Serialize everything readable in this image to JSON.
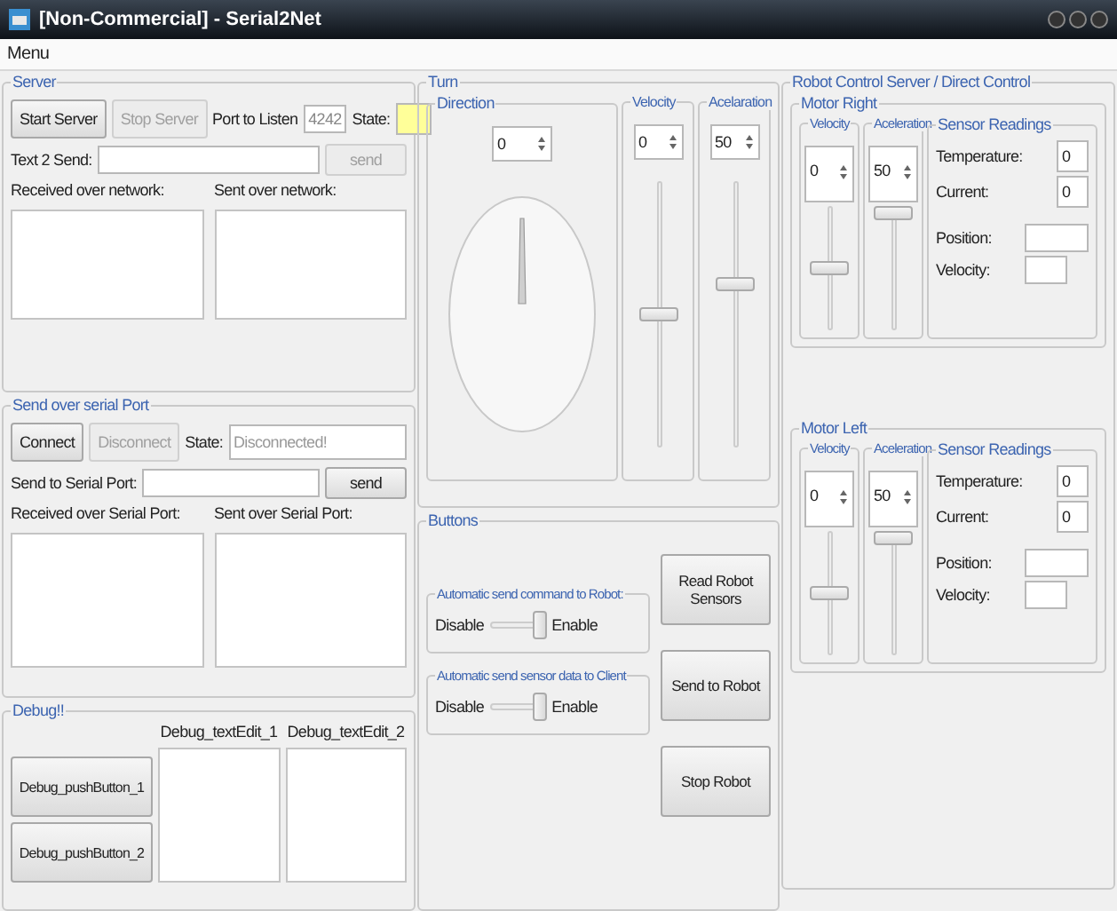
{
  "window": {
    "title": "[Non-Commercial] - Serial2Net"
  },
  "menu": [
    "Menu"
  ],
  "server": {
    "title": "Server",
    "buttons": [
      {
        "label": "Start Server",
        "disabled": false
      },
      {
        "label": "Stop Server",
        "disabled": true
      }
    ],
    "port_label": "Port to Listen",
    "port": "4242",
    "state_label": "State:",
    "text_label": "Text 2 Send:",
    "send": {
      "label": "send",
      "disabled": true
    },
    "received_label": "Received over network:",
    "sent_label": "Sent over network:"
  },
  "serial": {
    "title": "Send over serial Port",
    "buttons": [
      {
        "label": "Connect",
        "disabled": false
      },
      {
        "label": "Disconnect",
        "disabled": true
      }
    ],
    "state_label": "State:",
    "state": "Disconnected!",
    "send_label": "Send to Serial Port:",
    "send": {
      "label": "send",
      "disabled": false
    },
    "received_label": "Received over Serial Port:",
    "sent_label": "Sent over Serial Port:"
  },
  "debug": {
    "title": "Debug!!",
    "buttons": [
      "Debug_pushButton_1",
      "Debug_pushButton_2"
    ],
    "edits": [
      "Debug_textEdit_1",
      "Debug_textEdit_2"
    ]
  },
  "turn": {
    "title": "Turn",
    "direction": {
      "title": "Direction",
      "value": "0"
    },
    "sliders": [
      {
        "title": "Velocity",
        "value": "0",
        "level": 0.5
      },
      {
        "title": "Acelaration",
        "value": "50",
        "level": 0.62
      }
    ]
  },
  "buttons_group": {
    "title": "Buttons",
    "toggles": [
      {
        "title": "Automatic send command to Robot:",
        "off": "Disable",
        "on": "Enable",
        "enabled": true
      },
      {
        "title": "Automatic send sensor data to Client",
        "off": "Disable",
        "on": "Enable",
        "enabled": true
      }
    ],
    "actions": [
      "Read Robot Sensors",
      "Send to Robot",
      "Stop Robot"
    ]
  },
  "robot": {
    "title": "Robot Control Server / Direct Control",
    "motors": [
      {
        "title": "Motor Right",
        "sliders": [
          {
            "title": "Velocity",
            "value": "0",
            "level": 0.5
          },
          {
            "title": "Aceleration",
            "value": "50",
            "level": 1
          }
        ],
        "sensors": {
          "title": "Sensor Readings",
          "fields": [
            {
              "label": "Temperature:",
              "value": "0"
            },
            {
              "label": "Current:",
              "value": "0"
            },
            {
              "label": "Position:"
            },
            {
              "label": "Velocity:"
            }
          ]
        }
      },
      {
        "title": "Motor Left",
        "sliders": [
          {
            "title": "Velocity",
            "value": "0",
            "level": 0.5
          },
          {
            "title": "Aceleration",
            "value": "50",
            "level": 1
          }
        ],
        "sensors": {
          "title": "Sensor Readings",
          "fields": [
            {
              "label": "Temperature:",
              "value": "0"
            },
            {
              "label": "Current:",
              "value": "0"
            },
            {
              "label": "Position:"
            },
            {
              "label": "Velocity:"
            }
          ]
        }
      }
    ]
  }
}
